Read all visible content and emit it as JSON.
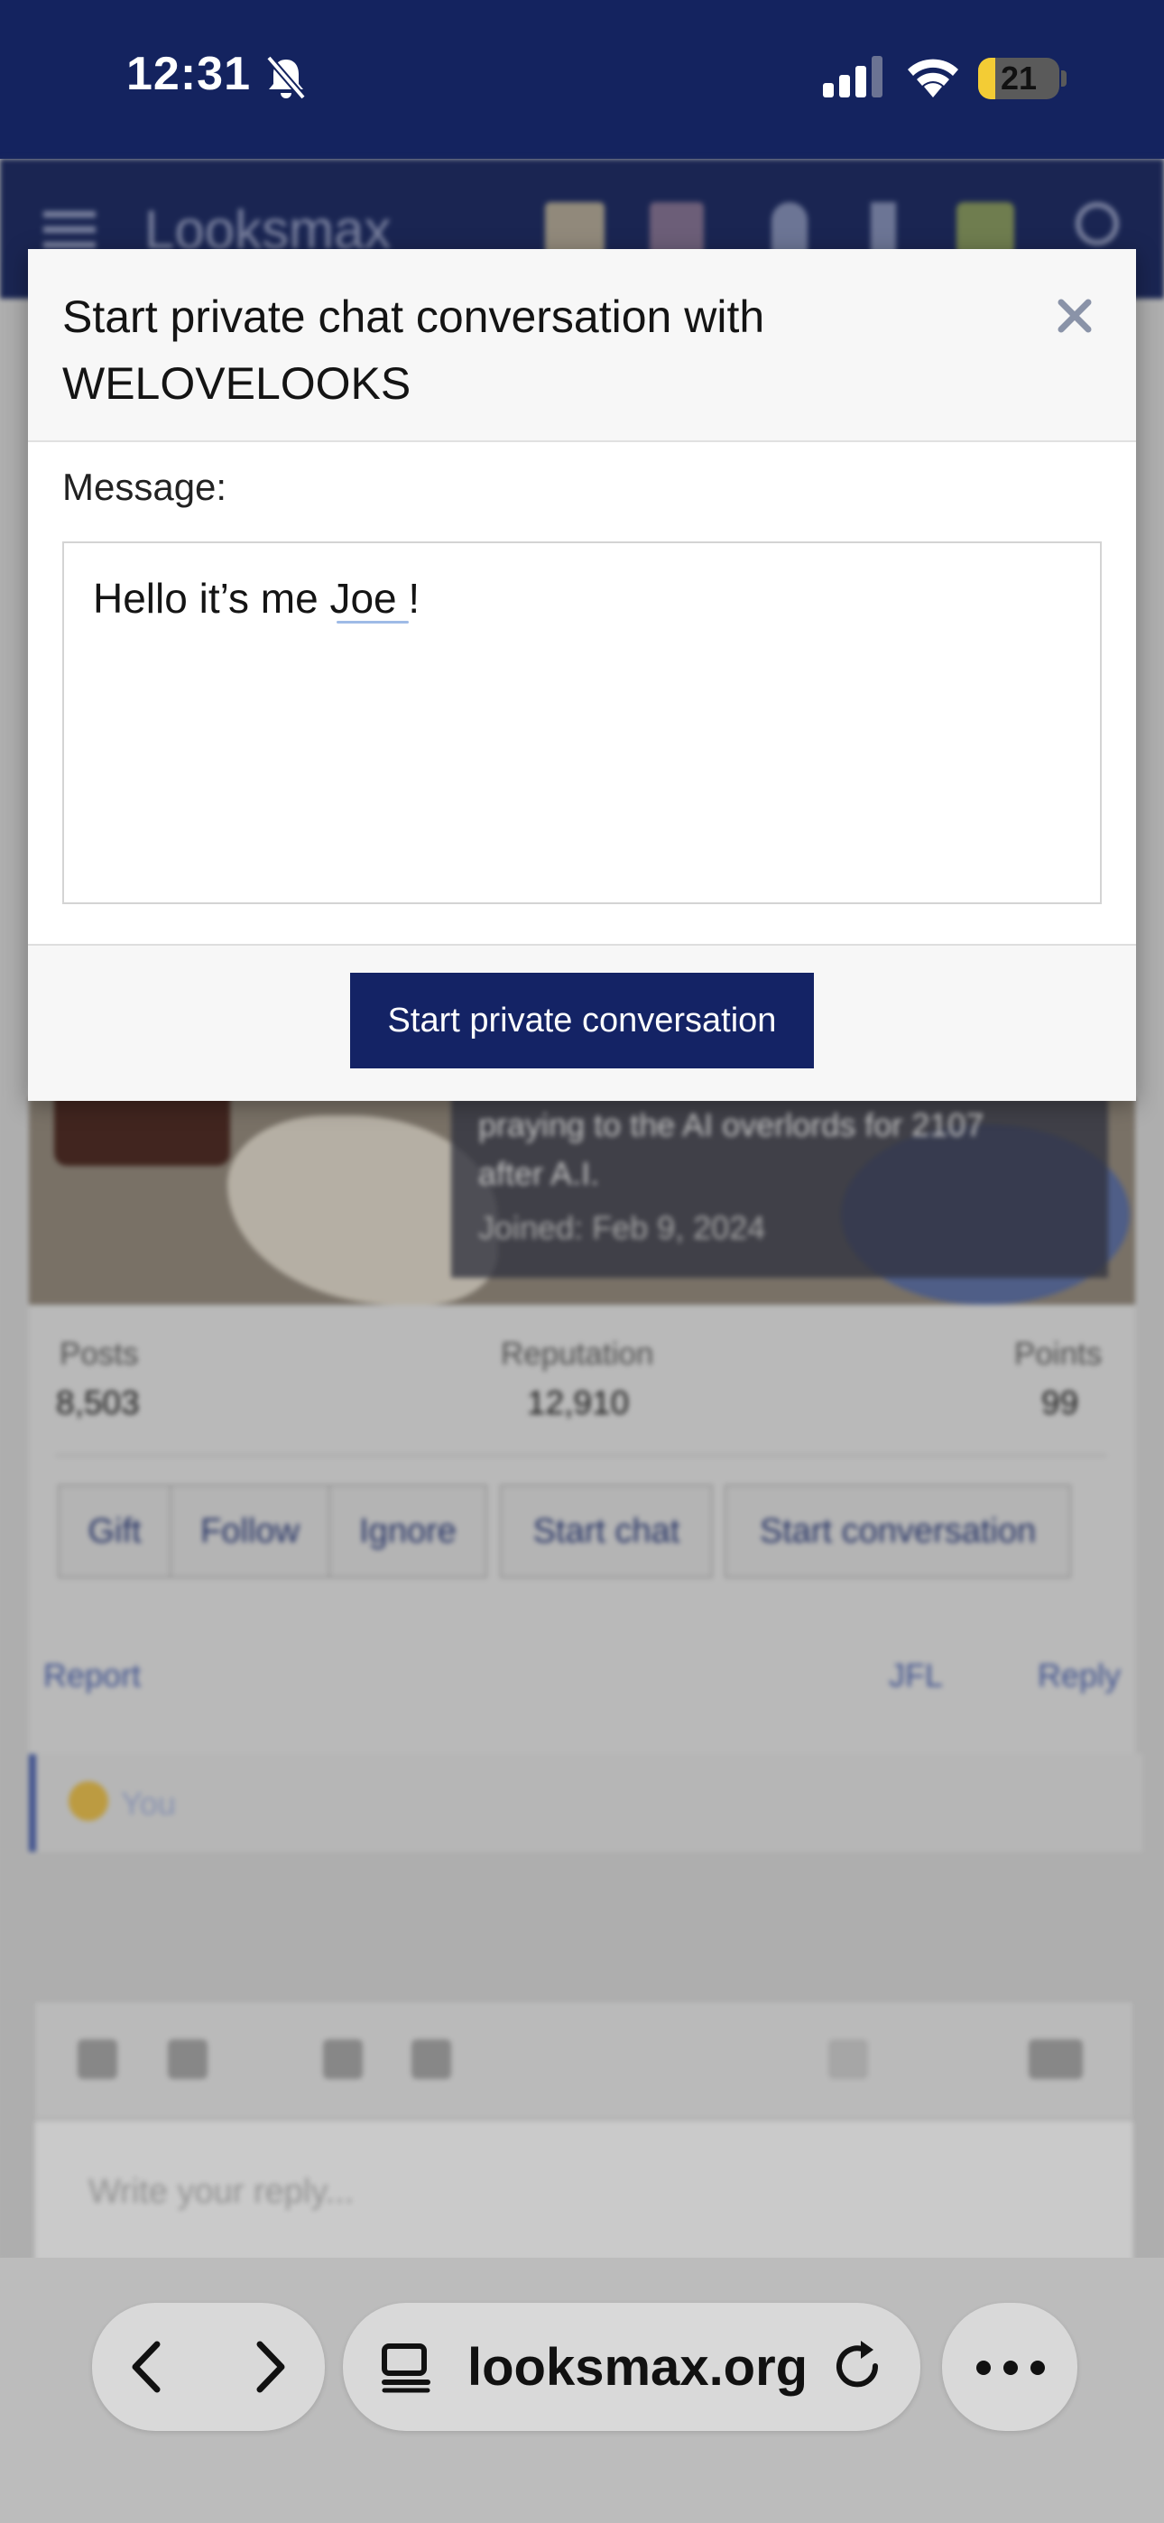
{
  "status_bar": {
    "time": "12:31",
    "battery": "21",
    "battery_level_percent": 21,
    "icons": [
      "bell-slash-icon",
      "cellular-signal-icon",
      "wifi-icon",
      "battery-icon"
    ]
  },
  "background": {
    "site_logo": "Looksmax",
    "profile": {
      "bio_line_1": "praying to the AI overlords for 2107",
      "bio_line_2": "after A.I.",
      "joined": "Joined: Feb 9, 2024"
    },
    "stats": [
      {
        "label": "Posts",
        "value": "8,503"
      },
      {
        "label": "Reputation",
        "value": "12,910"
      },
      {
        "label": "Points",
        "value": "99"
      }
    ],
    "buttons": [
      "Gift",
      "Follow",
      "Ignore",
      "Start chat",
      "Start conversation"
    ],
    "post_actions": {
      "report": "Report",
      "jfl": "JFL",
      "reply": "Reply"
    },
    "reaction": "You",
    "editor_placeholder": "Write your reply..."
  },
  "modal": {
    "title": "Start private chat conversation with WELOVELOOKS",
    "close_icon": "close-icon",
    "message_label": "Message:",
    "message_value": "Hello it’s me Joe !",
    "submit_label": "Start private conversation",
    "accent_color": "#142365"
  },
  "browser": {
    "url": "looksmax.org",
    "icons": [
      "back-icon",
      "forward-icon",
      "page-menu-icon",
      "reload-icon",
      "more-icon"
    ]
  }
}
